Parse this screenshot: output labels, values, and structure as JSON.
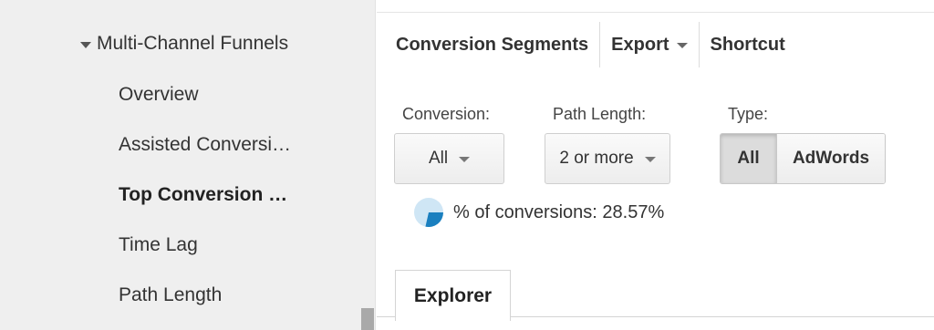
{
  "sidebar": {
    "section_label": "Multi-Channel Funnels",
    "items": [
      {
        "label": "Overview"
      },
      {
        "label": "Assisted Conversi…"
      },
      {
        "label": "Top Conversion …"
      },
      {
        "label": "Time Lag"
      },
      {
        "label": "Path Length"
      }
    ],
    "active_item": "Top Conversion …"
  },
  "toolbar": {
    "segments_label": "Conversion Segments",
    "export_label": "Export",
    "shortcut_label": "Shortcut"
  },
  "filters": {
    "conversion": {
      "label": "Conversion:",
      "value": "All"
    },
    "path_length": {
      "label": "Path Length:",
      "value": "2 or more"
    },
    "type": {
      "label": "Type:",
      "options": [
        "All",
        "AdWords"
      ],
      "selected": "All"
    }
  },
  "metric": {
    "text": "% of conversions: 28.57%",
    "fraction": 0.2857,
    "colors": {
      "fill": "#1a7fbf",
      "track": "#cfe6f5"
    }
  },
  "tabs": [
    {
      "label": "Explorer",
      "active": true
    }
  ]
}
